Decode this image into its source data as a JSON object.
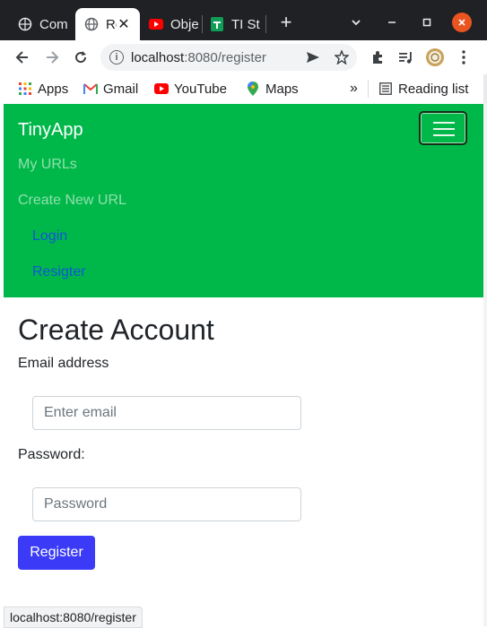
{
  "browser": {
    "tabs": [
      {
        "title": "Com",
        "icon": "globe-icon",
        "active": false
      },
      {
        "title": "Re",
        "icon": "globe-icon",
        "active": true
      },
      {
        "title": "Obje",
        "icon": "youtube-icon",
        "active": false
      },
      {
        "title": "TI St",
        "icon": "sheets-icon",
        "active": false
      }
    ],
    "new_tab_glyph": "+",
    "close_glyph": "✕",
    "address": {
      "host": "localhost",
      "rest": ":8080/register"
    },
    "bookmarks": [
      {
        "label": "Apps",
        "icon": "apps-grid-icon"
      },
      {
        "label": "Gmail",
        "icon": "gmail-icon"
      },
      {
        "label": "YouTube",
        "icon": "youtube-icon"
      },
      {
        "label": "Maps",
        "icon": "maps-pin-icon"
      }
    ],
    "more_glyph": "»",
    "reading_list": "Reading list",
    "status_url": "localhost:8080/register"
  },
  "navbar": {
    "brand": "TinyApp",
    "links": [
      {
        "label": "My URLs",
        "style": "muted"
      },
      {
        "label": "Create New URL",
        "style": "muted"
      },
      {
        "label": "Login",
        "style": "blue"
      },
      {
        "label": "Resigter",
        "style": "blue"
      }
    ],
    "bg_color": "#00b84a"
  },
  "form": {
    "heading": "Create Account",
    "email_label": "Email address",
    "email_placeholder": "Enter email",
    "password_label": "Password:",
    "password_placeholder": "Password",
    "submit_label": "Register",
    "submit_color": "#3b3bf7"
  }
}
